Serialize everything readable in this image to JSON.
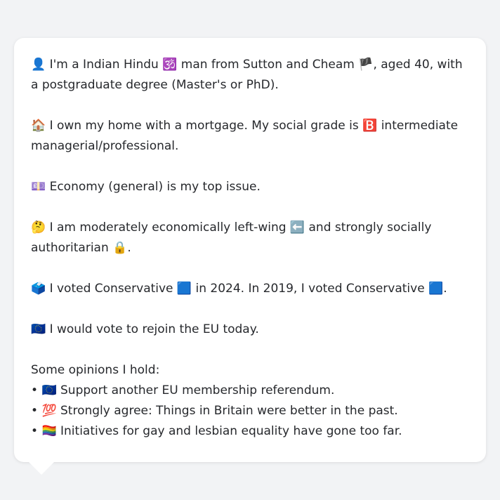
{
  "profile": {
    "identity": {
      "icon": "👤",
      "text_a": "I'm a Indian Hindu",
      "hindu_icon": "🕉️",
      "text_b": "man from Sutton and Cheam",
      "flag_icon": "🏴",
      "text_c": ", aged 40, with a postgraduate degree (Master's or PhD)."
    },
    "home": {
      "icon": "🏠",
      "text_a": "I own my home with a mortgage. My social grade is",
      "grade_icon": "🅱️",
      "text_b": "intermediate managerial/professional."
    },
    "issue": {
      "icon": "💷",
      "text": "Economy (general) is my top issue."
    },
    "ideology": {
      "icon": "🤔",
      "text_a": "I am moderately economically left-wing",
      "left_icon": "⬅️",
      "text_b": "and strongly socially authoritarian",
      "lock_icon": "🔒",
      "text_c": "."
    },
    "vote": {
      "icon": "🗳️",
      "text_a": "I voted Conservative",
      "party_icon_1": "🟦",
      "text_b": "in 2024. In 2019, I voted Conservative",
      "party_icon_2": "🟦",
      "text_c": "."
    },
    "eu": {
      "icon": "🇪🇺",
      "text": "I would vote to rejoin the EU today."
    },
    "opinions_heading": "Some opinions I hold:",
    "opinions": [
      {
        "bullet": "•",
        "icon": "🇪🇺",
        "text": "Support another EU membership referendum."
      },
      {
        "bullet": "•",
        "icon": "💯",
        "text": "Strongly agree: Things in Britain were better in the past."
      },
      {
        "bullet": "•",
        "icon": "🏳️‍🌈",
        "text": "Initiatives for gay and lesbian equality have gone too far."
      }
    ]
  },
  "colors": {
    "background": "#f2f3f5",
    "card": "#ffffff",
    "text": "#26282c"
  }
}
